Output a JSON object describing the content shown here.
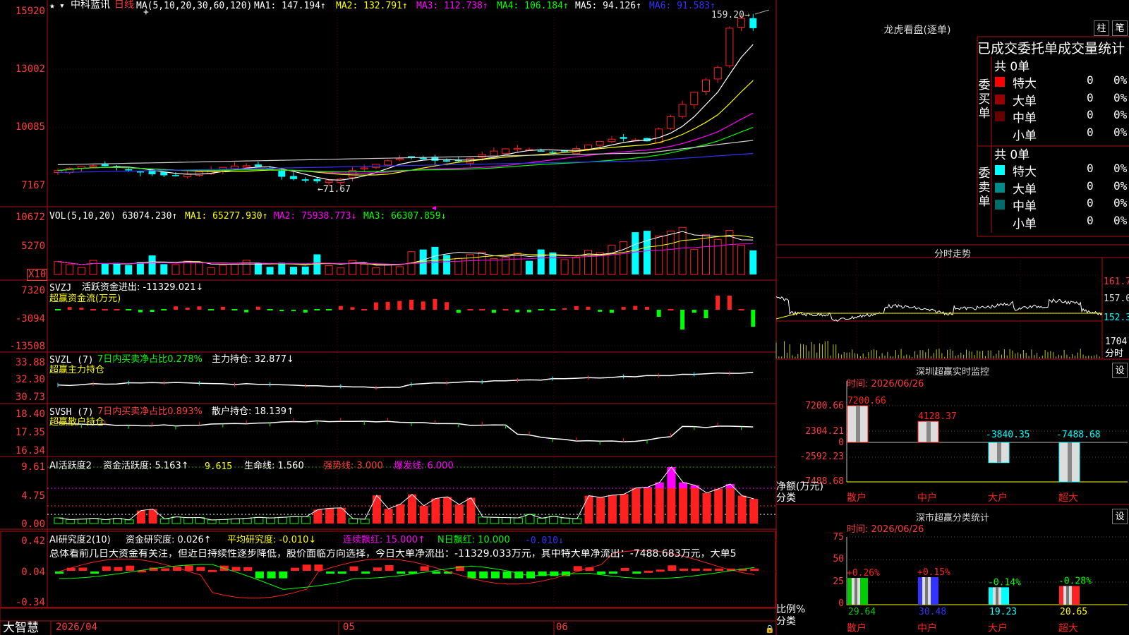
{
  "header": {
    "star": "★",
    "stock_name": "中科蓝讯",
    "period": "日线",
    "ma_label": "MA(5,10,20,30,60,120)",
    "ma1": "MA1: 147.194↑",
    "ma2": "MA2: 132.791↑",
    "ma3": "MA3: 112.738↑",
    "ma4": "MA4: 106.184↑",
    "ma5": "MA5: 94.126↑",
    "ma6": "MA6: 91.583↑"
  },
  "price_axis": [
    "15920",
    "13002",
    "10085",
    "7167"
  ],
  "price_marks": {
    "high": "159.20→",
    "low": "←71.67"
  },
  "vol": {
    "axis": [
      "10672",
      "5270"
    ],
    "scale": "X10",
    "title": "VOL(5,10,20)",
    "value": "63074.230↑",
    "ma1": "MA1: 65277.930↑",
    "ma2": "MA2: 75938.773↓",
    "ma3": "MA3: 66307.859↓"
  },
  "svzj": {
    "axis": [
      "7320",
      "-3094",
      "-13508"
    ],
    "title": "SVZJ",
    "text": "活跃资金进出: -11329.021↓",
    "sub": "超赢资金流(万元)"
  },
  "svzl": {
    "axis": [
      "33.88",
      "32.30",
      "30.73"
    ],
    "title": "SVZL (7)",
    "ratio": "7日内买卖净占比0.278%",
    "text": "主力持仓: 32.877↓",
    "sub": "超赢主力持仓"
  },
  "svsh": {
    "axis": [
      "18.40",
      "17.35",
      "16.34"
    ],
    "title": "SVSH (7)",
    "ratio": "7日内买卖净占比0.893%",
    "text": "散户持仓: 18.139↑",
    "sub": "超赢散户持仓"
  },
  "ai_active": {
    "axis": [
      "9.61",
      "4.75",
      "0.00"
    ],
    "title": "AI活跃度2",
    "t1": "资金活跃度: 5.163↑",
    "t2": "9.615",
    "t3": "生命线: 1.560",
    "t4": "强势线: 3.000",
    "t5": "爆发线: 6.000"
  },
  "ai_research": {
    "axis": [
      "0.42",
      "0.04",
      "-0.34"
    ],
    "title": "AI研究度2(10)",
    "t1": "资金研究度: 0.026↑",
    "t2": "平均研究度: -0.010↓",
    "t3": "连续飘红: 15.000↑",
    "t4": "N日飘红: 10.000",
    "t5": "-0.010↓",
    "summary": "总体看前几日大资金有关注，但近日持续性逐步降低，股价面临方向选择，今日大单净流出：-11329.033万元，其中特大单净流出：-7488.683万元，大单5"
  },
  "xaxis": {
    "brand": "大智慧",
    "d1": "2026/04",
    "d2": "05",
    "d3": "06"
  },
  "lhb": {
    "title": "龙虎看盘(逐单)",
    "btn1": "柱",
    "btn2": "笔",
    "head": "已成交委托单成交量统计",
    "buy_label": "委买单",
    "sell_label": "委卖单",
    "buy_total": "共 0单",
    "sell_total": "共 0单",
    "buy_rows": [
      {
        "name": "特大",
        "count": "0",
        "pct": "0%",
        "color": "#ff0000"
      },
      {
        "name": "大单",
        "count": "0",
        "pct": "0%",
        "color": "#990000"
      },
      {
        "name": "中单",
        "count": "0",
        "pct": "0%",
        "color": "#660000"
      },
      {
        "name": "小单",
        "count": "0",
        "pct": "0%",
        "color": ""
      }
    ],
    "sell_rows": [
      {
        "name": "特大",
        "count": "0",
        "pct": "0%",
        "color": "#00ffff"
      },
      {
        "name": "大单",
        "count": "0",
        "pct": "0%",
        "color": "#008b8b"
      },
      {
        "name": "中单",
        "count": "0",
        "pct": "0%",
        "color": "#006b6b"
      },
      {
        "name": "小单",
        "count": "0",
        "pct": "0%",
        "color": ""
      }
    ]
  },
  "intraday": {
    "title": "分时走势",
    "axis": [
      "161.7",
      "157.0",
      "152.3"
    ],
    "vol_axis": "1704",
    "vol_label": "分时"
  },
  "sz_monitor": {
    "title": "深圳超赢实时监控",
    "btn": "设",
    "time": "时间: 2026/06/26",
    "axis": [
      "7200.66",
      "2304.21",
      "0",
      "-2592.23",
      "-7488.68"
    ],
    "ylabel1": "净额(万元)",
    "ylabel2": "分类",
    "categories": [
      "散户",
      "中户",
      "大户",
      "超大"
    ],
    "values": [
      7200.66,
      4128.37,
      -3840.35,
      -7488.68
    ],
    "value_labels": [
      "7200.66",
      "4128.37",
      "-3840.35",
      "-7488.68"
    ]
  },
  "sz_category": {
    "title": "深市超赢分类统计",
    "btn": "设",
    "time": "时间: 2026/06/26",
    "axis": [
      "75",
      "50",
      "25",
      "0"
    ],
    "ylabel1": "比例%",
    "ylabel2": "分类",
    "categories": [
      "散户",
      "中户",
      "大户",
      "超大"
    ],
    "values": [
      29.64,
      30.48,
      19.23,
      20.65
    ],
    "changes": [
      "+0.26%",
      "+0.15%",
      "-0.14%",
      "-0.28%"
    ],
    "value_labels": [
      "29.64",
      "30.48",
      "19.23",
      "20.65"
    ],
    "colors": [
      "#00cc00",
      "#3333ff",
      "#00ffff",
      "#ff2222"
    ]
  },
  "chart_data": [
    {
      "type": "bar",
      "title": "深圳超赢实时监控",
      "ylabel": "净额(万元)",
      "categories": [
        "散户",
        "中户",
        "大户",
        "超大"
      ],
      "values": [
        7200.66,
        4128.37,
        -3840.35,
        -7488.68
      ],
      "ylim": [
        -7488.68,
        7200.66
      ]
    },
    {
      "type": "bar",
      "title": "深市超赢分类统计",
      "ylabel": "比例%",
      "categories": [
        "散户",
        "中户",
        "大户",
        "超大"
      ],
      "values": [
        29.64,
        30.48,
        19.23,
        20.65
      ],
      "ylim": [
        0,
        75
      ]
    }
  ]
}
